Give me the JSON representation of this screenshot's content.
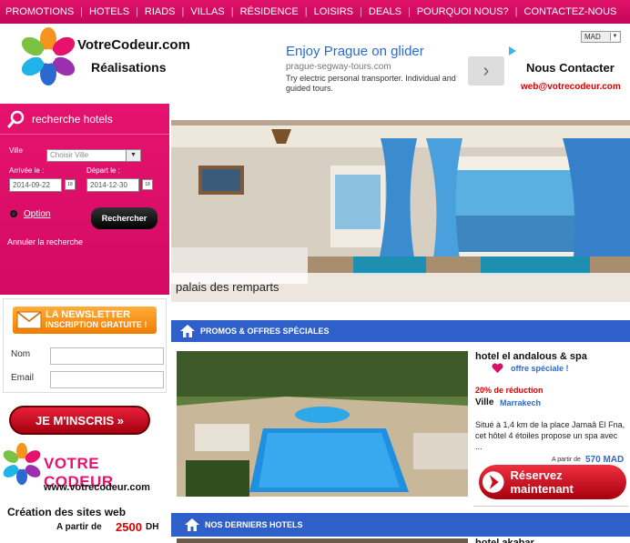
{
  "nav": {
    "items": [
      "PROMOTIONS",
      "HOTELS",
      "RIADS",
      "VILLAS",
      "RÉSIDENCE",
      "LOISIRS",
      "DEALS",
      "POURQUOI NOUS?",
      "CONTACTEZ-NOUS"
    ]
  },
  "header": {
    "brand_name": "VotreCodeur.com",
    "brand_sub": "Réalisations",
    "currency": "MAD",
    "contact_title": "Nous Contacter",
    "contact_email": "web@votrecodeur.com"
  },
  "ad": {
    "title": "Enjoy Prague on glider",
    "url": "prague-segway-tours.com",
    "description": "Try electric personal transporter. Individual and guided tours."
  },
  "search": {
    "title": "recherche hotels",
    "city_label": "Ville",
    "city_placeholder": "Choisir Ville",
    "arrival_label": "Arrivée le :",
    "arrival_value": "2014-09-22",
    "departure_label": "Départ le :",
    "departure_value": "2014-12-30",
    "calendar_label": "18",
    "option_label": "Option",
    "search_button": "Rechercher",
    "cancel_label": "Annuler la recherche"
  },
  "newsletter": {
    "badge_line1": "LA NEWSLETTER",
    "badge_line2": "INSCRIPTION GRATUITE !",
    "name_label": "Nom",
    "email_label": "Email",
    "subscribe_button": "JE M'INSCRIS »"
  },
  "side_promo": {
    "logo_text": "VOTRE CODEUR",
    "url": "www.votrecodeur.com",
    "headline": "Création des sites web",
    "price_label": "A partir de",
    "price": "2500",
    "price_unit": "DH"
  },
  "slider": {
    "caption": "palais des remparts"
  },
  "promos": {
    "section_title": "PROMOS & OFFRES SPÈCIALES",
    "hotel_name": "hotel el andalous & spa",
    "offer_label": "offre spéciale !",
    "discount": "20% de réduction",
    "city_label": "Ville",
    "city": "Marrakech",
    "description": "Situé à 1,4 km de la place Jamaâ El Fna, cet hôtel 4 étoiles propose un spa avec ...",
    "price_label": "A partir de",
    "price": "570 MAD",
    "reserve_button": "Réservez maintenant"
  },
  "recent": {
    "section_title": "NOS DERNIERS HOTELS",
    "hotel_name": "hotel akabar"
  },
  "colors": {
    "brand_pink": "#e0126a",
    "section_blue": "#2f5fc9",
    "accent_red": "#d80000",
    "link_blue": "#2a6ad0"
  }
}
